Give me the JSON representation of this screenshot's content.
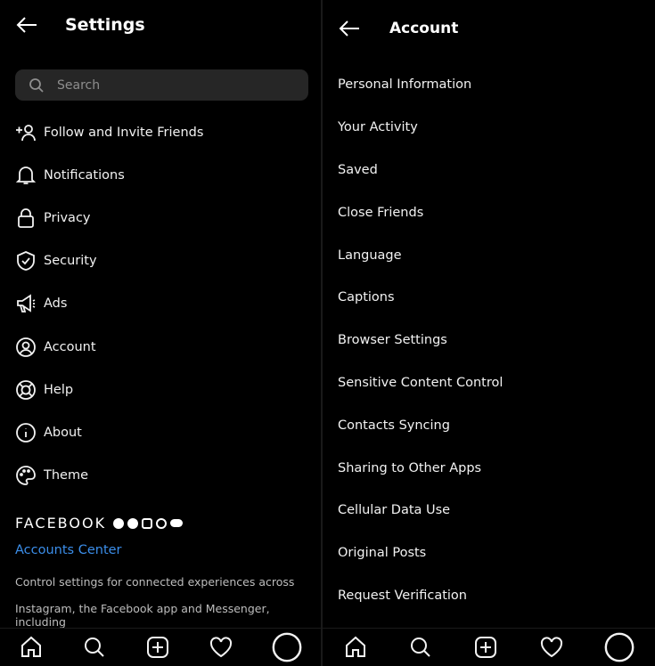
{
  "settings": {
    "title": "Settings",
    "search_placeholder": "Search",
    "items": [
      {
        "label": "Follow and Invite Friends",
        "icon": "add-person-icon"
      },
      {
        "label": "Notifications",
        "icon": "bell-icon"
      },
      {
        "label": "Privacy",
        "icon": "lock-icon"
      },
      {
        "label": "Security",
        "icon": "shield-icon"
      },
      {
        "label": "Ads",
        "icon": "megaphone-icon"
      },
      {
        "label": "Account",
        "icon": "account-icon"
      },
      {
        "label": "Help",
        "icon": "lifebuoy-icon"
      },
      {
        "label": "About",
        "icon": "info-icon"
      },
      {
        "label": "Theme",
        "icon": "palette-icon"
      }
    ],
    "facebook_label": "FACEBOOK",
    "accounts_center": "Accounts Center",
    "desc_line1": "Control settings for connected experiences across",
    "desc_line2": "Instagram, the Facebook app and Messenger, including"
  },
  "account": {
    "title": "Account",
    "items": [
      "Personal Information",
      "Your Activity",
      "Saved",
      "Close Friends",
      "Language",
      "Captions",
      "Browser Settings",
      "Sensitive Content Control",
      "Contacts Syncing",
      "Sharing to Other Apps",
      "Cellular Data Use",
      "Original Posts",
      "Request Verification"
    ]
  },
  "nav": [
    "home-icon",
    "search-icon",
    "new-post-icon",
    "heart-icon",
    "profile-icon"
  ],
  "colors": {
    "background": "#000000",
    "accent": "#3b8eea",
    "search_bg": "#262626"
  }
}
